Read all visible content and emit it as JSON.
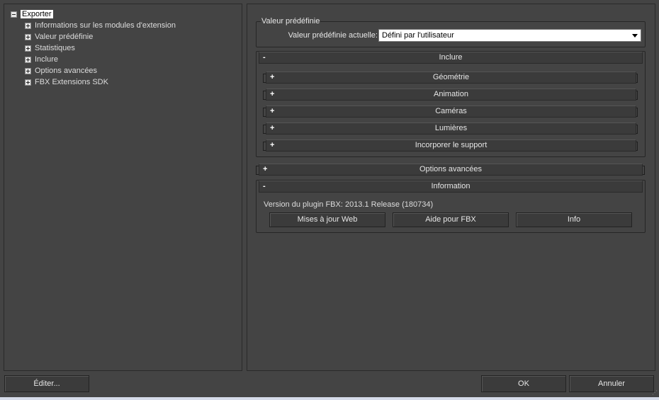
{
  "tree": {
    "root_label": "Exporter",
    "children": [
      "Informations sur les modules d'extension",
      "Valeur prédéfinie",
      "Statistiques",
      "Inclure",
      "Options avancées",
      "FBX Extensions SDK"
    ]
  },
  "preset": {
    "group_title": "Valeur prédéfinie",
    "current_label": "Valeur prédéfinie actuelle:",
    "current_value": "Défini par l'utilisateur"
  },
  "include": {
    "title": "Inclure",
    "state": "-",
    "sections": [
      "Géométrie",
      "Animation",
      "Caméras",
      "Lumières",
      "Incorporer le support"
    ],
    "section_state": "+"
  },
  "advanced": {
    "title": "Options avancées",
    "state": "+"
  },
  "information": {
    "title": "Information",
    "state": "-",
    "version_text": "Version du plugin FBX: 2013.1 Release (180734)",
    "buttons": [
      "Mises à jour Web",
      "Aide pour FBX",
      "Info"
    ]
  },
  "footer": {
    "edit_label": "Éditer...",
    "ok_label": "OK",
    "cancel_label": "Annuler"
  }
}
